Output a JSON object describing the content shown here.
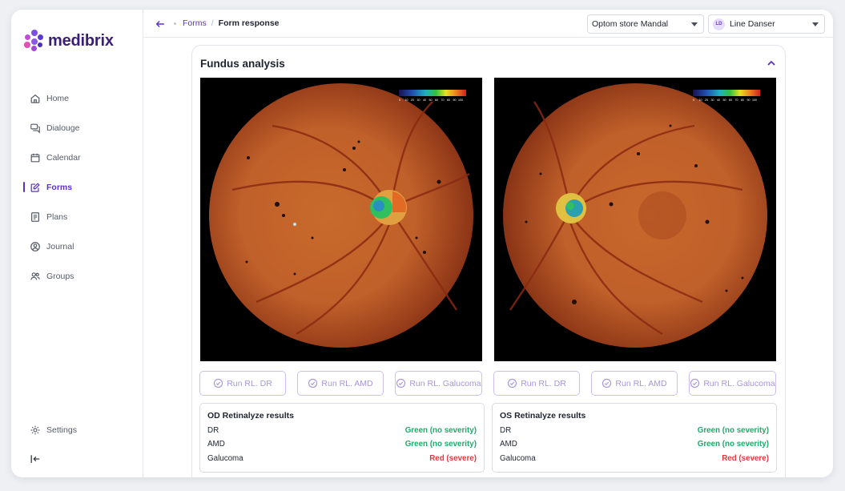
{
  "brand": {
    "name": "medibrix"
  },
  "sidebar": {
    "items": [
      {
        "label": "Home",
        "icon": "home-icon"
      },
      {
        "label": "Dialouge",
        "icon": "chat-icon"
      },
      {
        "label": "Calendar",
        "icon": "calendar-icon"
      },
      {
        "label": "Forms",
        "icon": "forms-icon",
        "active": true
      },
      {
        "label": "Plans",
        "icon": "plans-icon"
      },
      {
        "label": "Journal",
        "icon": "journal-icon"
      },
      {
        "label": "Groups",
        "icon": "groups-icon"
      }
    ],
    "settings_label": "Settings"
  },
  "header": {
    "breadcrumb": {
      "parent": "Forms",
      "separator": "/",
      "current": "Form response"
    },
    "store_select": "Optom store Mandal",
    "user": {
      "initials": "LD",
      "name": "Line Danser"
    }
  },
  "section": {
    "title": "Fundus analysis",
    "eyes": [
      {
        "run_buttons": [
          "Run RL. DR",
          "Run RL. AMD",
          "Run RL. Galucoma"
        ],
        "results_title": "OD Retinalyze results",
        "results": [
          {
            "label": "DR",
            "value": "Green (no severity)",
            "status": "green"
          },
          {
            "label": "AMD",
            "value": "Green (no severity)",
            "status": "green"
          },
          {
            "label": "Galucoma",
            "value": "Red (severe)",
            "status": "red"
          }
        ]
      },
      {
        "run_buttons": [
          "Run RL. DR",
          "Run RL. AMD",
          "Run RL. Galucoma"
        ],
        "results_title": "OS Retinalyze results",
        "results": [
          {
            "label": "DR",
            "value": "Green (no severity)",
            "status": "green"
          },
          {
            "label": "AMD",
            "value": "Green (no severity)",
            "status": "green"
          },
          {
            "label": "Galucoma",
            "value": "Red (severe)",
            "status": "red"
          }
        ]
      }
    ],
    "heatmap_scale_labels": [
      "0",
      "10",
      "20",
      "30",
      "40",
      "50",
      "60",
      "70",
      "80",
      "90",
      "100"
    ]
  },
  "colors": {
    "accent": "#5b30c8",
    "status_green": "#1faa6b",
    "status_red": "#e03b3b"
  }
}
